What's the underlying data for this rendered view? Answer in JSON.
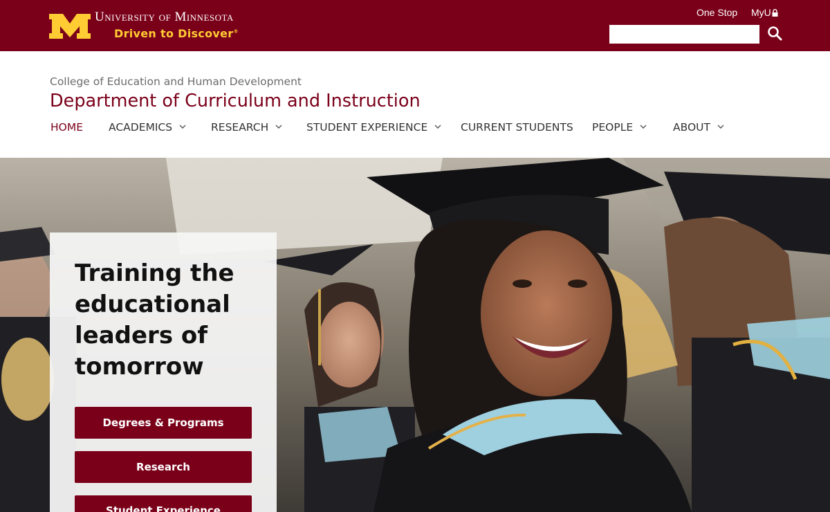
{
  "brand": {
    "wordmark": "University of Minnesota",
    "tagline": "Driven to Discover",
    "tagline_mark": "®",
    "maroon": "#7a0019",
    "gold": "#ffcc33"
  },
  "utility_nav": {
    "one_stop": "One Stop",
    "myu": "MyU",
    "search_value": "",
    "search_icon": "search-icon",
    "lock_icon": "lock-icon"
  },
  "header": {
    "college": "College of Education and Human Development",
    "department": "Department of Curriculum and Instruction"
  },
  "nav": {
    "items": [
      {
        "label": "HOME",
        "active": true,
        "dropdown": false
      },
      {
        "label": "ACADEMICS",
        "active": false,
        "dropdown": true
      },
      {
        "label": "RESEARCH",
        "active": false,
        "dropdown": true
      },
      {
        "label": "STUDENT EXPERIENCE",
        "active": false,
        "dropdown": true
      },
      {
        "label": "CURRENT STUDENTS",
        "active": false,
        "dropdown": false
      },
      {
        "label": "PEOPLE",
        "active": false,
        "dropdown": true
      },
      {
        "label": "ABOUT",
        "active": false,
        "dropdown": true
      }
    ]
  },
  "hero": {
    "headline_lines": [
      "Training the",
      "educational",
      "leaders of",
      "tomorrow"
    ],
    "buttons": [
      "Degrees & Programs",
      "Research",
      "Student Experience"
    ]
  }
}
